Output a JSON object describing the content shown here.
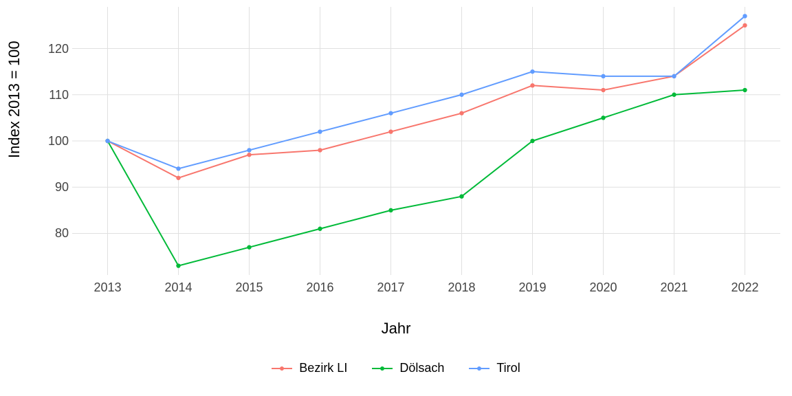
{
  "chart_data": {
    "type": "line",
    "title": "",
    "xlabel": "Jahr",
    "ylabel": "Index  2013  =  100",
    "x": [
      2013,
      2014,
      2015,
      2016,
      2017,
      2018,
      2019,
      2020,
      2021,
      2022
    ],
    "x_ticks": [
      2013,
      2014,
      2015,
      2016,
      2017,
      2018,
      2019,
      2020,
      2021,
      2022
    ],
    "y_ticks": [
      80,
      90,
      100,
      110,
      120
    ],
    "xlim": [
      2012.5,
      2022.5
    ],
    "ylim": [
      71,
      129
    ],
    "legend_position": "bottom",
    "grid": true,
    "series": [
      {
        "name": "Bezirk LI",
        "color": "#f8766d",
        "values": [
          100,
          92,
          97,
          98,
          102,
          106,
          112,
          111,
          114,
          125
        ]
      },
      {
        "name": "Dölsach",
        "color": "#00ba38",
        "values": [
          100,
          73,
          77,
          81,
          85,
          88,
          100,
          105,
          110,
          111
        ]
      },
      {
        "name": "Tirol",
        "color": "#619cff",
        "values": [
          100,
          94,
          98,
          102,
          106,
          110,
          115,
          114,
          114,
          127
        ]
      }
    ]
  }
}
